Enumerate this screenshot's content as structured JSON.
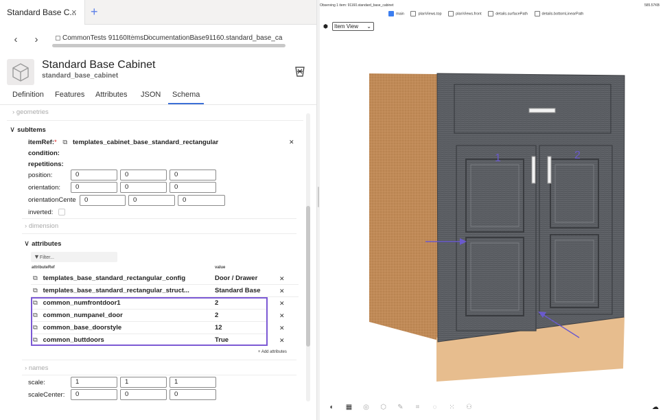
{
  "tab": {
    "title": "Standard Base C...",
    "close": "×",
    "new": "+"
  },
  "nav": {
    "back": "‹",
    "forward": "›"
  },
  "breadcrumb": [
    "CommonTests 91160",
    "Items",
    "Documentation",
    "Base",
    "91160.standard_base_ca"
  ],
  "item": {
    "title": "Standard Base Cabinet",
    "subtitle": "standard_base_cabinet"
  },
  "tabs": [
    "Definition",
    "Features",
    "Attributes",
    "JSON",
    "Schema"
  ],
  "schema": {
    "geometries": "geometries",
    "subitems": "subItems",
    "itemref_label": "itemRef:",
    "required": "*",
    "itemref_value": "templates_cabinet_base_standard_rectangular",
    "condition": "condition:",
    "repetitions": "repetitions:",
    "position": {
      "label": "position:",
      "values": [
        "0",
        "0",
        "0"
      ]
    },
    "orientation": {
      "label": "orientation:",
      "values": [
        "0",
        "0",
        "0"
      ]
    },
    "orientationCenter": {
      "label": "orientationCente",
      "values": [
        "0",
        "0",
        "0"
      ]
    },
    "inverted": "inverted:",
    "dimension": "dimension",
    "attributes_label": "attributes",
    "filter_placeholder": "Filter...",
    "col_ref": "attributeRef",
    "col_value": "value",
    "attributes": [
      {
        "ref": "templates_base_standard_rectangular_config",
        "value": "Door / Drawer"
      },
      {
        "ref": "templates_base_standard_rectangular_struct...",
        "value": "Standard Base"
      },
      {
        "ref": "common_numfrontdoor1",
        "value": "2"
      },
      {
        "ref": "common_numpanel_door",
        "value": "2"
      },
      {
        "ref": "common_base_doorstyle",
        "value": "12"
      },
      {
        "ref": "common_buttdoors",
        "value": "True"
      }
    ],
    "add_attr": "+ Add attributes",
    "names": "names",
    "scale": {
      "label": "scale:",
      "values": [
        "1",
        "1",
        "1"
      ]
    },
    "scaleCenter": {
      "label": "scaleCenter:",
      "values": [
        "0",
        "0",
        "0"
      ]
    }
  },
  "viewer": {
    "observing": "Observing 1 item: 91160.standard_base_cabinet",
    "size": "585.57KB",
    "checks": [
      {
        "label": "main",
        "on": true
      },
      {
        "label": "planViews.top",
        "on": false
      },
      {
        "label": "planViews.front",
        "on": false
      },
      {
        "label": "details.surfacePath",
        "on": false
      },
      {
        "label": "details.bottomLinearPath",
        "on": false
      }
    ],
    "view_select": "Item View",
    "door_labels": [
      "1",
      "2"
    ]
  },
  "colors": {
    "accent": "#3b6fd6",
    "highlight": "#7b58d4",
    "cabinet": "#5a5d62",
    "wood": "#c99863"
  }
}
